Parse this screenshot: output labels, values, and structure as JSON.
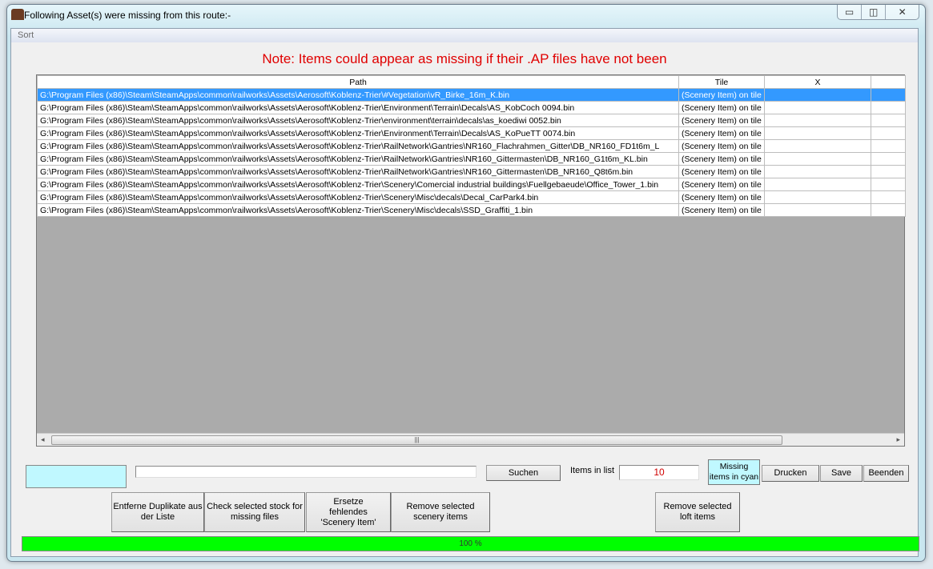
{
  "window": {
    "title": "Following Asset(s) were missing from this route:-",
    "controls": {
      "minimize": "▭",
      "maximize": "◫",
      "close": "✕"
    }
  },
  "menu": {
    "sort": "Sort"
  },
  "note": "Note: Items could appear as missing if their .AP files have not been",
  "table": {
    "columns": [
      "Path",
      "Tile",
      "X",
      ""
    ],
    "rows": [
      {
        "path": "G:\\Program Files (x86)\\Steam\\SteamApps\\common\\railworks\\Assets\\Aerosoft\\Koblenz-Trier\\#Vegetation\\vR_Birke_16m_K.bin",
        "tile": "(Scenery Item) on tile",
        "selected": true
      },
      {
        "path": "G:\\Program Files (x86)\\Steam\\SteamApps\\common\\railworks\\Assets\\Aerosoft\\Koblenz-Trier\\Environment\\Terrain\\Decals\\AS_KobCoch 0094.bin",
        "tile": "(Scenery Item) on tile"
      },
      {
        "path": "G:\\Program Files (x86)\\Steam\\SteamApps\\common\\railworks\\Assets\\Aerosoft\\Koblenz-Trier\\environment\\terrain\\decals\\as_koediwi 0052.bin",
        "tile": "(Scenery Item) on tile"
      },
      {
        "path": "G:\\Program Files (x86)\\Steam\\SteamApps\\common\\railworks\\Assets\\Aerosoft\\Koblenz-Trier\\Environment\\Terrain\\Decals\\AS_KoPueTT 0074.bin",
        "tile": "(Scenery Item) on tile"
      },
      {
        "path": "G:\\Program Files (x86)\\Steam\\SteamApps\\common\\railworks\\Assets\\Aerosoft\\Koblenz-Trier\\RailNetwork\\Gantries\\NR160_Flachrahmen_Gitter\\DB_NR160_FD1t6m_L",
        "tile": "(Scenery Item) on tile"
      },
      {
        "path": "G:\\Program Files (x86)\\Steam\\SteamApps\\common\\railworks\\Assets\\Aerosoft\\Koblenz-Trier\\RailNetwork\\Gantries\\NR160_Gittermasten\\DB_NR160_G1t6m_KL.bin",
        "tile": "(Scenery Item) on tile"
      },
      {
        "path": "G:\\Program Files (x86)\\Steam\\SteamApps\\common\\railworks\\Assets\\Aerosoft\\Koblenz-Trier\\RailNetwork\\Gantries\\NR160_Gittermasten\\DB_NR160_Q8t6m.bin",
        "tile": "(Scenery Item) on tile"
      },
      {
        "path": "G:\\Program Files (x86)\\Steam\\SteamApps\\common\\railworks\\Assets\\Aerosoft\\Koblenz-Trier\\Scenery\\Comercial industrial buildings\\Fuellgebaeude\\Office_Tower_1.bin",
        "tile": "(Scenery Item) on tile"
      },
      {
        "path": "G:\\Program Files (x86)\\Steam\\SteamApps\\common\\railworks\\Assets\\Aerosoft\\Koblenz-Trier\\Scenery\\Misc\\decals\\Decal_CarPark4.bin",
        "tile": "(Scenery Item) on tile"
      },
      {
        "path": "G:\\Program Files (x86)\\Steam\\SteamApps\\common\\railworks\\Assets\\Aerosoft\\Koblenz-Trier\\Scenery\\Misc\\decals\\SSD_Graffiti_1.bin",
        "tile": "(Scenery Item) on tile"
      }
    ]
  },
  "scrollbar": {
    "left": "◂",
    "right": "▸",
    "grip": "|||"
  },
  "search": {
    "value": "",
    "button": "Suchen"
  },
  "items_in_list": {
    "label": "Items in list",
    "value": "10"
  },
  "legend": "Missing items in cyan",
  "buttons": {
    "print": "Drucken",
    "save": "Save",
    "exit": "Beenden",
    "remove_duplicates": "Entferne Duplikate aus der Liste",
    "check_stock": "Check selected stock for missing files",
    "replace_scenery": "Ersetze fehlendes 'Scenery Item'",
    "remove_scenery": "Remove selected scenery items",
    "remove_loft": "Remove selected loft items"
  },
  "progress": {
    "value": 100,
    "label": "100 %"
  },
  "colors": {
    "accent": "#3399ff",
    "note": "#e00000",
    "cyan": "#c0f8ff",
    "progress": "#00ff00"
  }
}
